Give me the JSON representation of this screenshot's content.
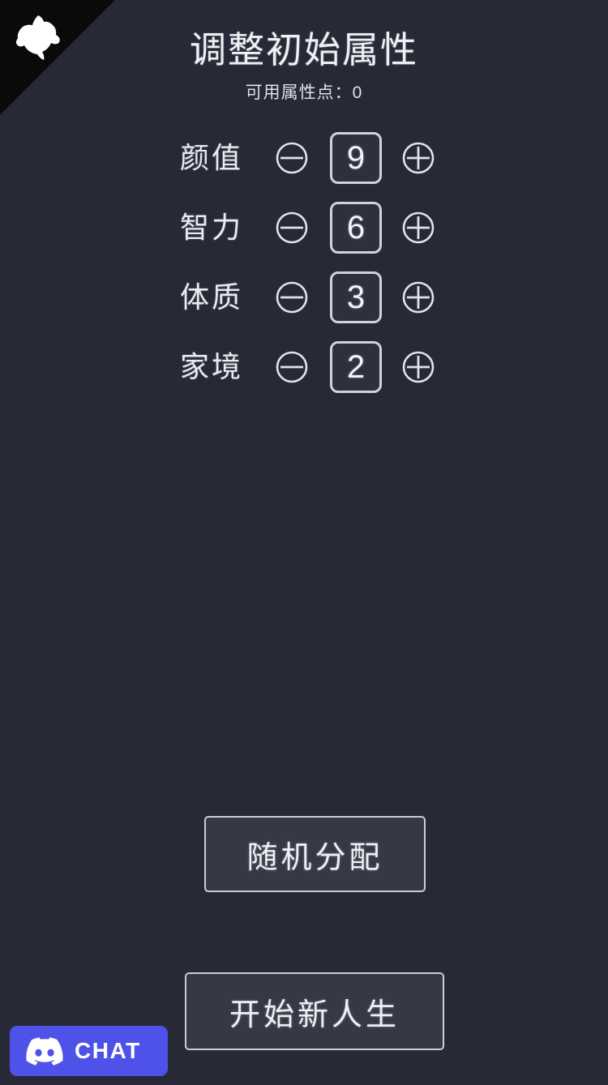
{
  "header": {
    "title": "调整初始属性",
    "available_points_label": "可用属性点：0"
  },
  "pet_icon": {
    "name": "pet-silhouette-icon"
  },
  "attributes": [
    {
      "label": "颜值",
      "value": "9",
      "decrement_icon": "minus-circle-icon",
      "increment_icon": "plus-circle-icon"
    },
    {
      "label": "智力",
      "value": "6",
      "decrement_icon": "minus-circle-icon",
      "increment_icon": "plus-circle-icon"
    },
    {
      "label": "体质",
      "value": "3",
      "decrement_icon": "minus-circle-icon",
      "increment_icon": "plus-circle-icon"
    },
    {
      "label": "家境",
      "value": "2",
      "decrement_icon": "minus-circle-icon",
      "increment_icon": "plus-circle-icon"
    }
  ],
  "actions": {
    "random_label": "随机分配",
    "start_label": "开始新人生"
  },
  "chat_widget": {
    "label": "CHAT",
    "icon": "discord-logo-icon",
    "background_color": "#4f52e8"
  },
  "colors": {
    "page_background": "#272a36",
    "corner_black": "#0a0a0c",
    "text_primary": "#eef0f6",
    "box_fill": "#2e313d",
    "button_fill": "#353945",
    "border": "#cfd3de"
  }
}
